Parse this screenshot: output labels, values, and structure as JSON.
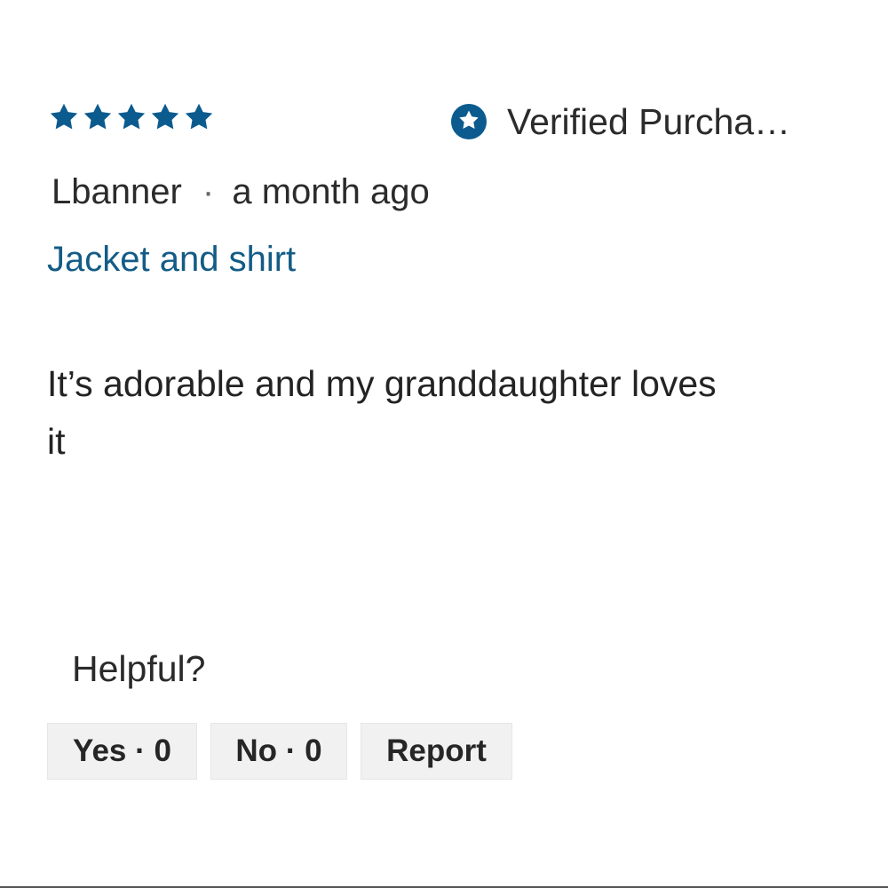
{
  "review": {
    "rating": 5,
    "rating_max": 5,
    "verified": {
      "icon": "verified-star-icon",
      "label": "Verified Purcha…"
    },
    "author": "Lbanner",
    "separator": "·",
    "time_ago": "a month ago",
    "title": "Jacket and shirt",
    "body": "It’s adorable and my granddaughter loves it"
  },
  "helpful": {
    "prompt": "Helpful?",
    "yes_label": "Yes · 0",
    "no_label": "No · 0",
    "report_label": "Report"
  },
  "colors": {
    "accent": "#0b5b8f",
    "title_link": "#135c86",
    "button_bg": "#f1f1f1"
  }
}
